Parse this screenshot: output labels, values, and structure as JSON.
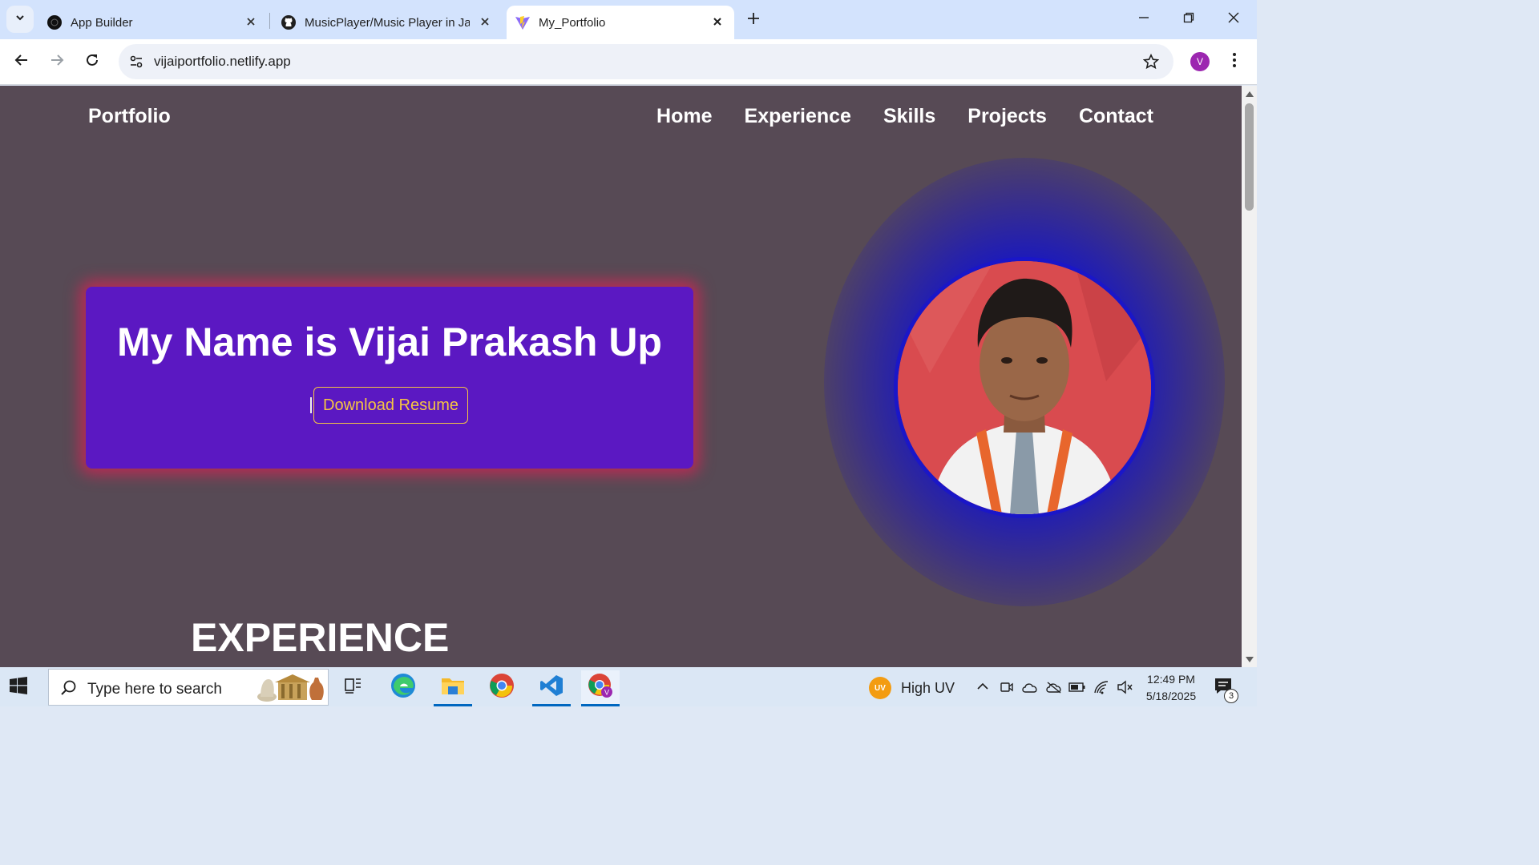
{
  "browser": {
    "tabs": [
      {
        "title": "App Builder",
        "active": false,
        "favicon": "app-builder-icon"
      },
      {
        "title": "MusicPlayer/Music Player in Jav",
        "active": false,
        "favicon": "github-icon"
      },
      {
        "title": "My_Portfolio",
        "active": true,
        "favicon": "vite-icon"
      }
    ],
    "url": "vijaiportfolio.netlify.app",
    "profile_initial": "V"
  },
  "page": {
    "brand": "Portfolio",
    "nav": [
      "Home",
      "Experience",
      "Skills",
      "Projects",
      "Contact"
    ],
    "hero_title": "My Name is Vijai Prakash Up",
    "resume_button": "Download Resume",
    "section_heading": "EXPERIENCE",
    "colors": {
      "page_bg": "#574a55",
      "hero_card": "#5b18c2",
      "hero_glow": "#b52d55",
      "button_accent": "#f5c542",
      "photo_glow": "#1414d2"
    }
  },
  "taskbar": {
    "search_placeholder": "Type here to search",
    "weather_badge": "UV",
    "weather_text": "High UV",
    "time": "12:49 PM",
    "date": "5/18/2025",
    "notification_count": "3"
  }
}
